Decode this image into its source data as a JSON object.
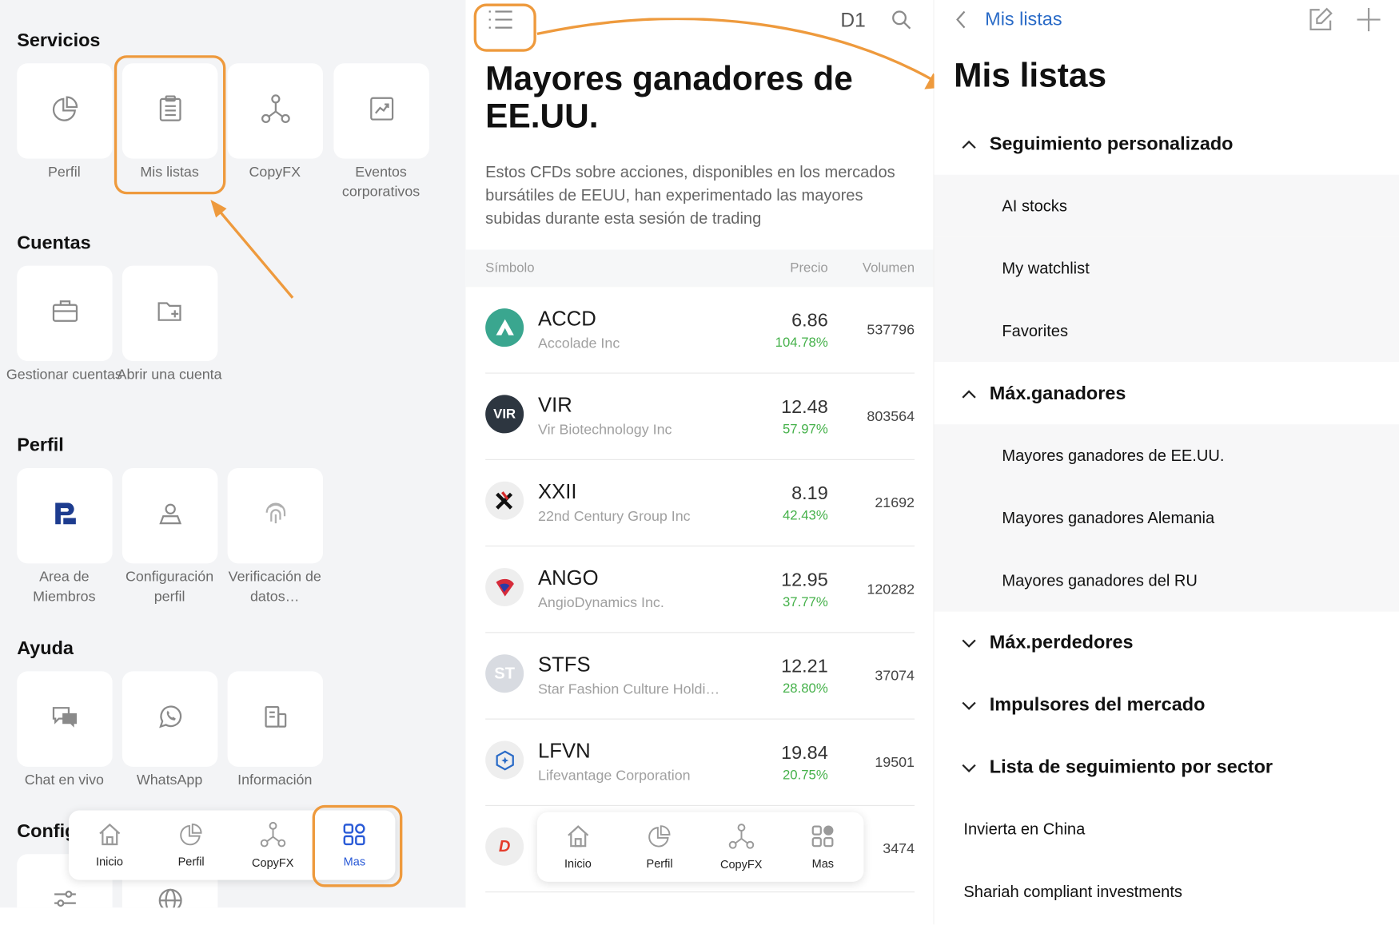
{
  "left": {
    "sections": {
      "servicios": "Servicios",
      "cuentas": "Cuentas",
      "perfil": "Perfil",
      "ayuda": "Ayuda",
      "config": "Config"
    },
    "tiles": {
      "perfil": "Perfil",
      "mis_listas": "Mis listas",
      "copyfx": "CopyFX",
      "eventos": "Eventos corporativos",
      "gestionar": "Gestionar cuentas",
      "abrir": "Abrir una cuenta",
      "area": "Area de Miembros",
      "configuracion": "Configuración perfil",
      "verificacion": "Verificación de datos…",
      "chat": "Chat en vivo",
      "whatsapp": "WhatsApp",
      "informacion": "Información"
    },
    "bottom_nav": [
      "Inicio",
      "Perfil",
      "CopyFX",
      "Mas"
    ]
  },
  "middle": {
    "period": "D1",
    "title": "Mayores ganadores de EE.UU.",
    "description": "Estos CFDs sobre acciones, disponibles en los mercados bursátiles de EEUU, han experimentado las mayores subidas durante esta sesión de trading",
    "columns": {
      "symbol": "Símbolo",
      "price": "Precio",
      "volume": "Volumen"
    },
    "rows": [
      {
        "symbol": "ACCD",
        "name": "Accolade Inc",
        "price": "6.86",
        "change": "104.78%",
        "volume": "537796"
      },
      {
        "symbol": "VIR",
        "name": "Vir Biotechnology Inc",
        "price": "12.48",
        "change": "57.97%",
        "volume": "803564"
      },
      {
        "symbol": "XXII",
        "name": "22nd Century Group Inc",
        "price": "8.19",
        "change": "42.43%",
        "volume": "21692"
      },
      {
        "symbol": "ANGO",
        "name": "AngioDynamics Inc.",
        "price": "12.95",
        "change": "37.77%",
        "volume": "120282"
      },
      {
        "symbol": "STFS",
        "name": "Star Fashion Culture Holdin…",
        "price": "12.21",
        "change": "28.80%",
        "volume": "37074"
      },
      {
        "symbol": "LFVN",
        "name": "Lifevantage Corporation",
        "price": "19.84",
        "change": "20.75%",
        "volume": "19501"
      },
      {
        "symbol": "",
        "name": "",
        "price": "",
        "change": "",
        "volume": "3474"
      }
    ],
    "logo_text": {
      "vir": "VIR",
      "st": "ST",
      "d": "D"
    },
    "bottom_nav": [
      "Inicio",
      "Perfil",
      "CopyFX",
      "Mas"
    ]
  },
  "right": {
    "back_label": "Mis listas",
    "title": "Mis listas",
    "groups": {
      "seguimiento": "Seguimiento personalizado",
      "max_ganadores": "Máx.ganadores",
      "max_perdedores": "Máx.perdedores",
      "impulsores": "Impulsores del mercado",
      "sector": "Lista de seguimiento por sector"
    },
    "seguimiento_items": [
      "AI stocks",
      "My watchlist",
      "Favorites"
    ],
    "ganadores_items": [
      "Mayores ganadores de EE.UU.",
      "Mayores ganadores Alemania",
      "Mayores ganadores del RU"
    ],
    "extra_items": [
      "Invierta en China",
      "Shariah compliant investments"
    ]
  },
  "colors": {
    "highlight": "#ee9a3d",
    "accent": "#2a5bd7",
    "gain": "#45b14a"
  }
}
